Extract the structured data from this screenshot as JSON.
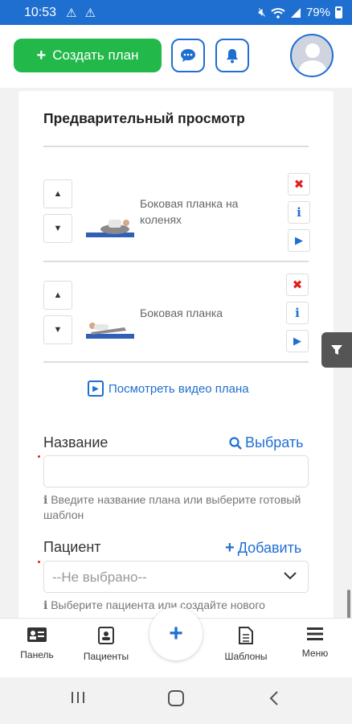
{
  "status_bar": {
    "time": "10:53",
    "battery": "79%"
  },
  "header": {
    "create_plan_label": "Создать план",
    "icons": [
      "chat-icon",
      "bell-icon",
      "avatar"
    ]
  },
  "preview": {
    "title": "Предварительный просмотр",
    "exercises": [
      {
        "name": "Боковая планка на коленях"
      },
      {
        "name": "Боковая планка"
      }
    ],
    "video_link": "Посмотреть видео плана"
  },
  "form": {
    "name": {
      "label": "Название",
      "action": "Выбрать",
      "value": "",
      "hint": "Введите название плана или выберите готовый шаблон"
    },
    "patient": {
      "label": "Пациент",
      "action": "Добавить",
      "selected": "--Не выбрано--",
      "hint": "Выберите пациента или создайте нового"
    }
  },
  "bottom_nav": {
    "items": [
      {
        "label": "Панель",
        "icon": "dashboard-icon"
      },
      {
        "label": "Пациенты",
        "icon": "patients-icon"
      },
      {
        "label": "Шаблоны",
        "icon": "templates-icon"
      },
      {
        "label": "Меню",
        "icon": "menu-icon"
      }
    ]
  },
  "colors": {
    "primary": "#1f6fd1",
    "success": "#22b94a",
    "danger": "#e02020"
  }
}
